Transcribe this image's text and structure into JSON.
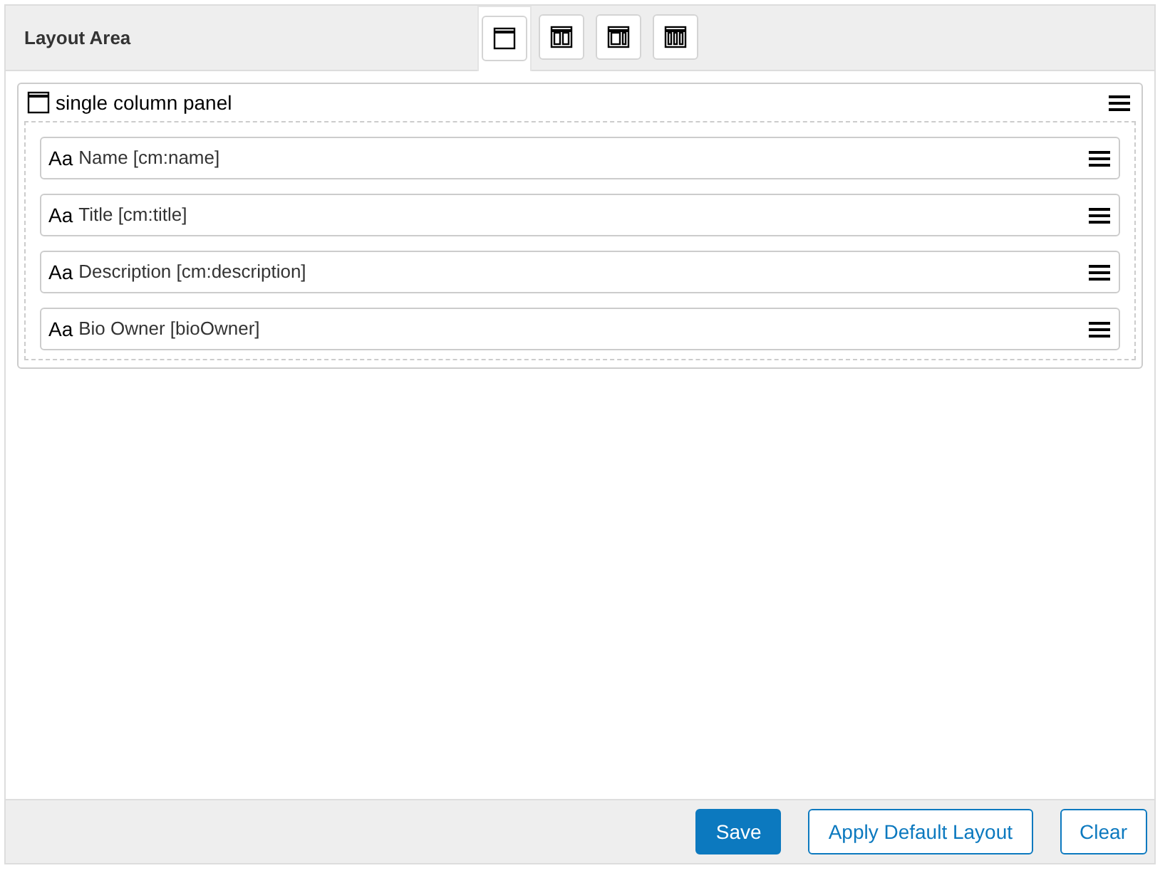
{
  "header": {
    "title": "Layout Area"
  },
  "layout_options": [
    {
      "kind": "single",
      "selected": true
    },
    {
      "kind": "two",
      "selected": false
    },
    {
      "kind": "sidebar",
      "selected": false
    },
    {
      "kind": "three",
      "selected": false
    }
  ],
  "panel": {
    "kind": "single",
    "title": "single column panel",
    "fields": [
      {
        "type_label": "Aa",
        "label": "Name [cm:name]"
      },
      {
        "type_label": "Aa",
        "label": "Title [cm:title]"
      },
      {
        "type_label": "Aa",
        "label": "Description [cm:description]"
      },
      {
        "type_label": "Aa",
        "label": "Bio Owner [bioOwner]"
      }
    ]
  },
  "buttons": [
    {
      "label": "Save",
      "kind": "primary"
    },
    {
      "label": "Apply Default Layout",
      "kind": "secondary"
    },
    {
      "label": "Clear",
      "kind": "secondary"
    }
  ]
}
